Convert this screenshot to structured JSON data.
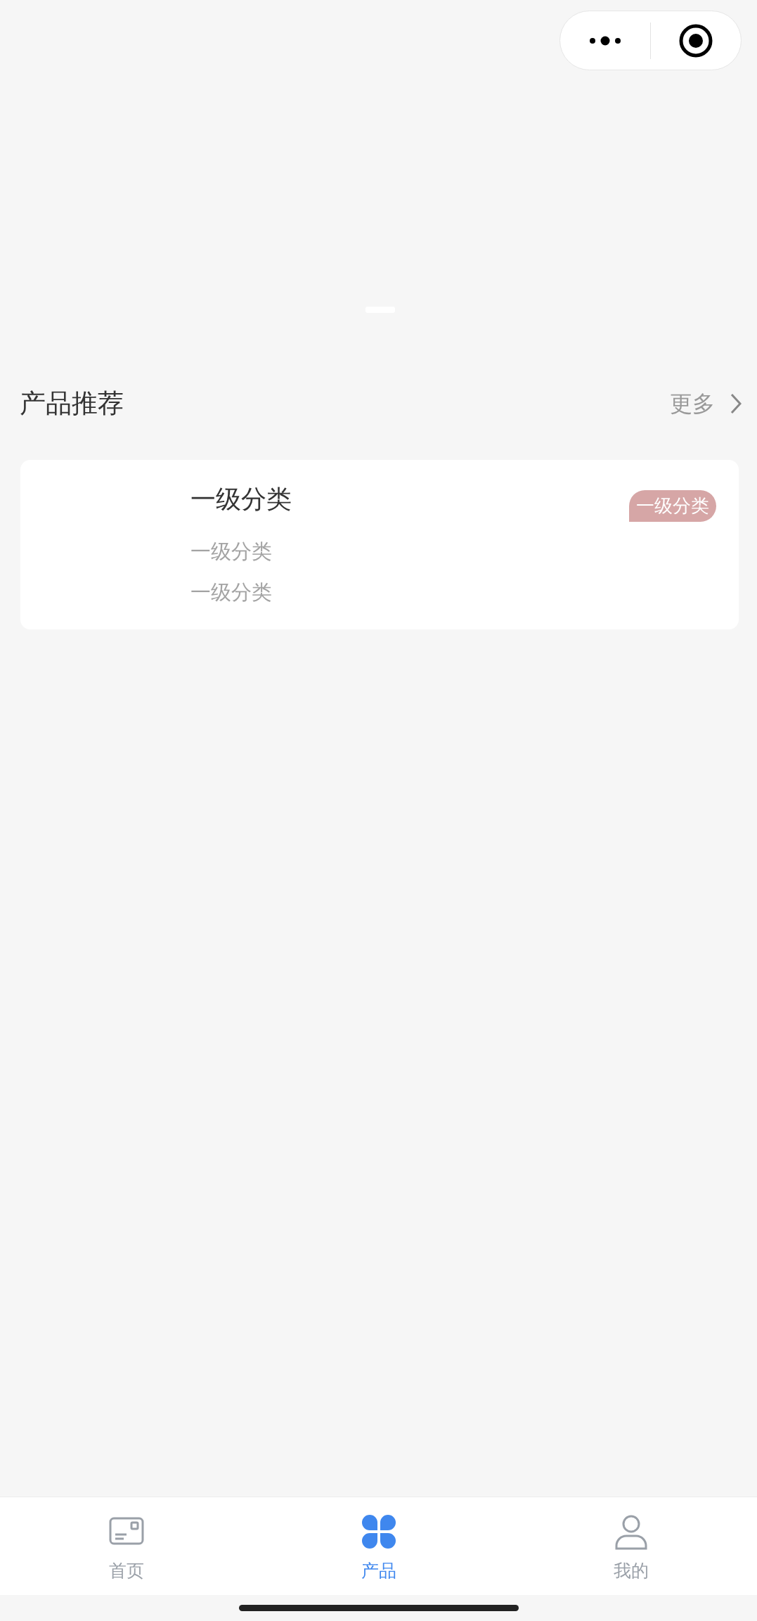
{
  "section": {
    "title": "产品推荐",
    "more": "更多"
  },
  "products": [
    {
      "title": "一级分类",
      "tag": "一级分类",
      "lines": [
        "一级分类",
        "一级分类"
      ]
    }
  ],
  "tabs": [
    {
      "label": "首页",
      "kind": "card",
      "selected": false
    },
    {
      "label": "产品",
      "kind": "clover",
      "selected": true
    },
    {
      "label": "我的",
      "kind": "person",
      "selected": false
    }
  ]
}
